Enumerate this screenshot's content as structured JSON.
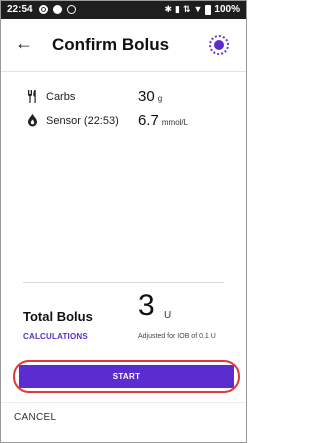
{
  "status_bar": {
    "time": "22:54",
    "icons": [
      "bluetooth-icon",
      "vibrate-icon",
      "signal-icon",
      "wifi-icon",
      "battery-icon"
    ],
    "battery": "100%"
  },
  "header": {
    "title": "Confirm Bolus",
    "back_icon": "arrow-left-icon",
    "pod_icon": "pod-status-icon",
    "accent": "#5b2ccf"
  },
  "details": [
    {
      "icon": "fork-knife-icon",
      "label": "Carbs",
      "value": "30",
      "unit": "g"
    },
    {
      "icon": "drop-icon",
      "label": "Sensor (22:53)",
      "value": "6.7",
      "unit": "mmol/L"
    }
  ],
  "total": {
    "label": "Total Bolus",
    "value": "3",
    "unit": "U",
    "calculations_label": "CALCULATIONS",
    "adjusted_note": "Adjusted for IOB of 0.1 U"
  },
  "actions": {
    "start_label": "START",
    "cancel_label": "CANCEL",
    "highlight_color": "#e0393a"
  }
}
